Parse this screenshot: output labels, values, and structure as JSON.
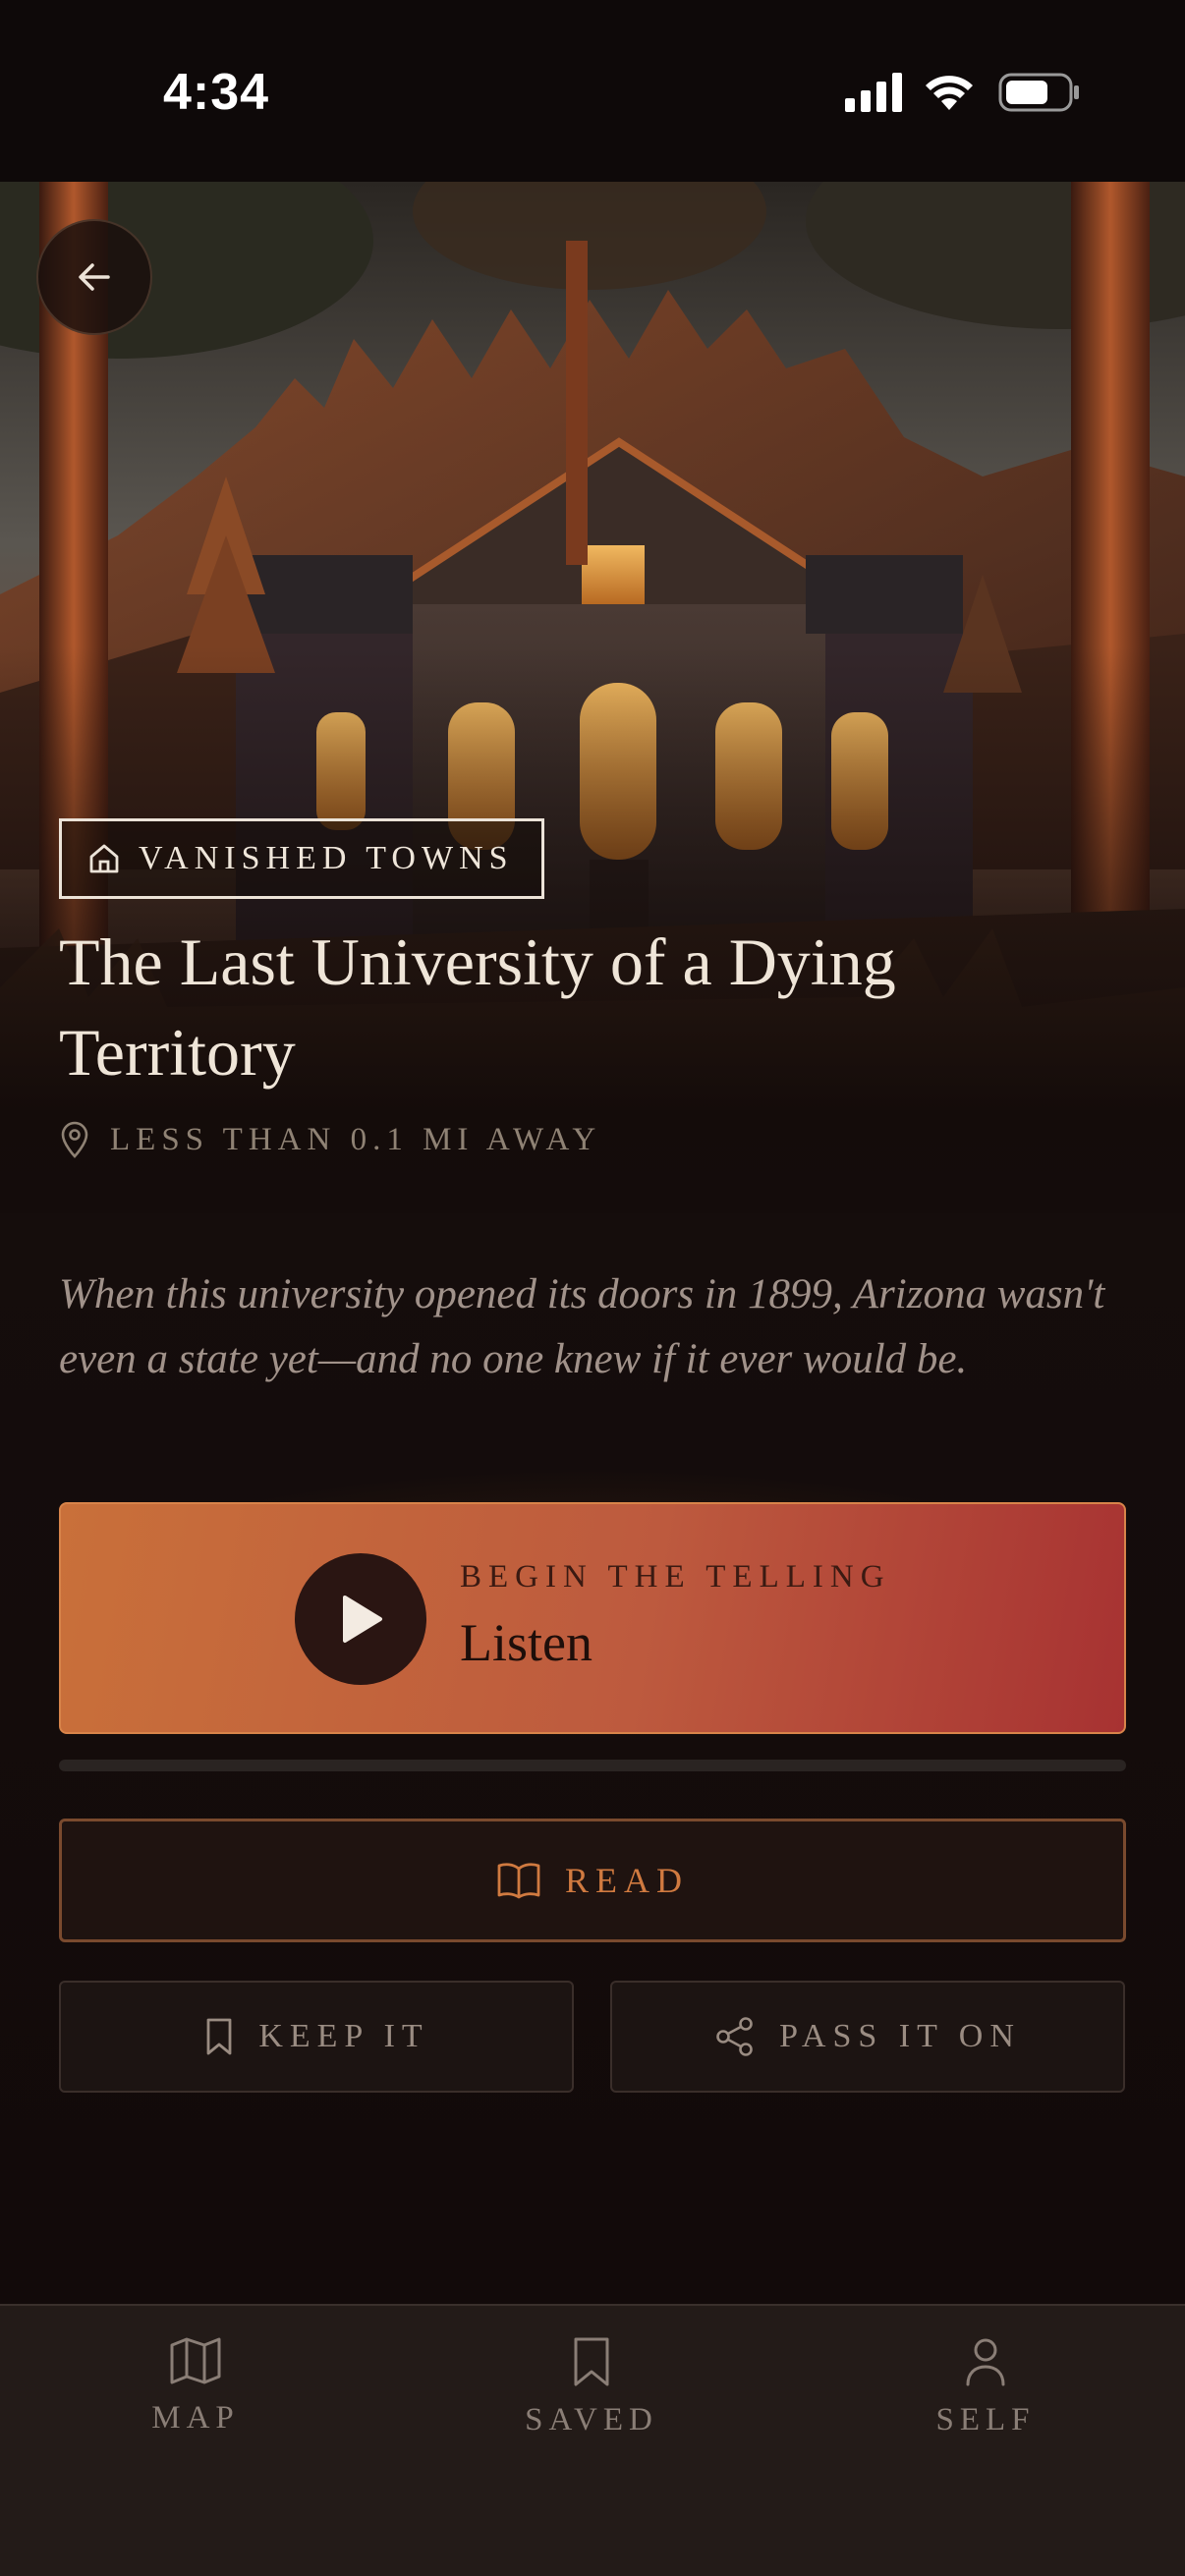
{
  "status_bar": {
    "time": "4:34"
  },
  "hero": {
    "category": "VANISHED TOWNS",
    "title": "The Last University of a Dying Territory",
    "distance": "LESS THAN 0.1 MI AWAY"
  },
  "story": {
    "intro": "When this university opened its doors in 1899, Arizona wasn't even a state yet—and no one knew if it ever would be."
  },
  "listen": {
    "eyebrow": "BEGIN THE TELLING",
    "label": "Listen",
    "progress": 0
  },
  "actions": {
    "read": "READ",
    "keep": "KEEP IT",
    "share": "PASS IT ON"
  },
  "nav": {
    "items": [
      {
        "label": "MAP",
        "icon": "map-icon"
      },
      {
        "label": "SAVED",
        "icon": "bookmark-icon"
      },
      {
        "label": "SELF",
        "icon": "person-icon"
      }
    ]
  },
  "colors": {
    "accent": "#d07a40",
    "listen_gradient_start": "#c9703a",
    "listen_gradient_end": "#a73232",
    "background": "#100909"
  }
}
